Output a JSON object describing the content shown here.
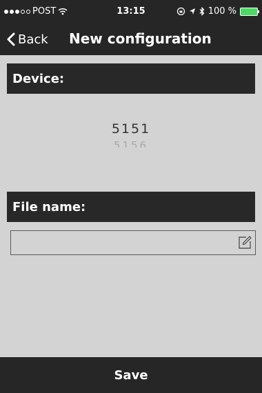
{
  "status_bar": {
    "carrier": "POST",
    "time": "13:15",
    "battery": "100 %"
  },
  "nav": {
    "back_label": "Back",
    "title": "New configuration"
  },
  "device_section": {
    "header": "Device:",
    "selected_value": "5151",
    "next_value": "5156"
  },
  "file_section": {
    "header": "File name:",
    "value": ""
  },
  "footer": {
    "save_label": "Save"
  },
  "colors": {
    "dark_bar": "#262626",
    "background": "#d3d3d3",
    "battery": "#4cd964"
  }
}
